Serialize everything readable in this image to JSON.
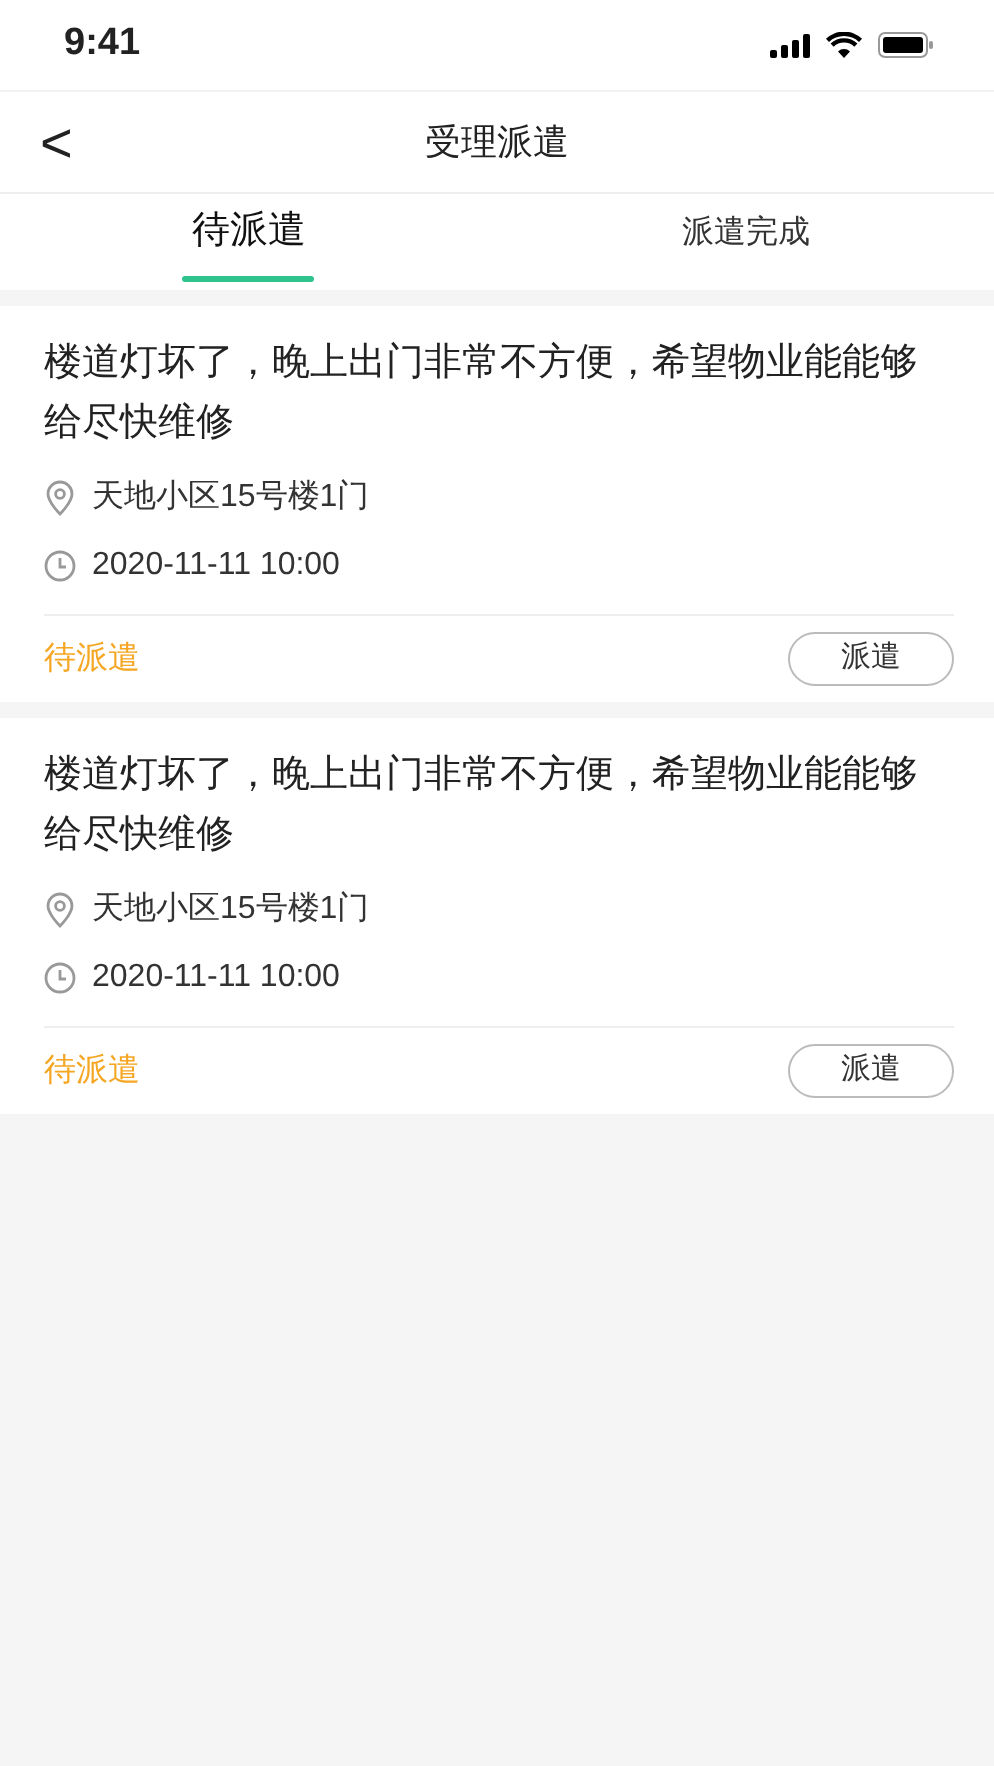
{
  "status_bar": {
    "time": "9:41"
  },
  "header": {
    "back": "<",
    "title": "受理派遣"
  },
  "tabs": [
    {
      "label": "待派遣",
      "selected": true
    },
    {
      "label": "派遣完成",
      "selected": false
    }
  ],
  "orders": [
    {
      "title": "楼道灯坏了，晚上出门非常不方便，希望物业能能够给尽快维修",
      "location": "天地小区15号楼1门",
      "time": "2020-11-11 10:00",
      "status": "待派遣",
      "action": "派遣"
    },
    {
      "title": "楼道灯坏了，晚上出门非常不方便，希望物业能能够给尽快维修",
      "location": "天地小区15号楼1门",
      "time": "2020-11-11 10:00",
      "status": "待派遣",
      "action": "派遣"
    }
  ]
}
